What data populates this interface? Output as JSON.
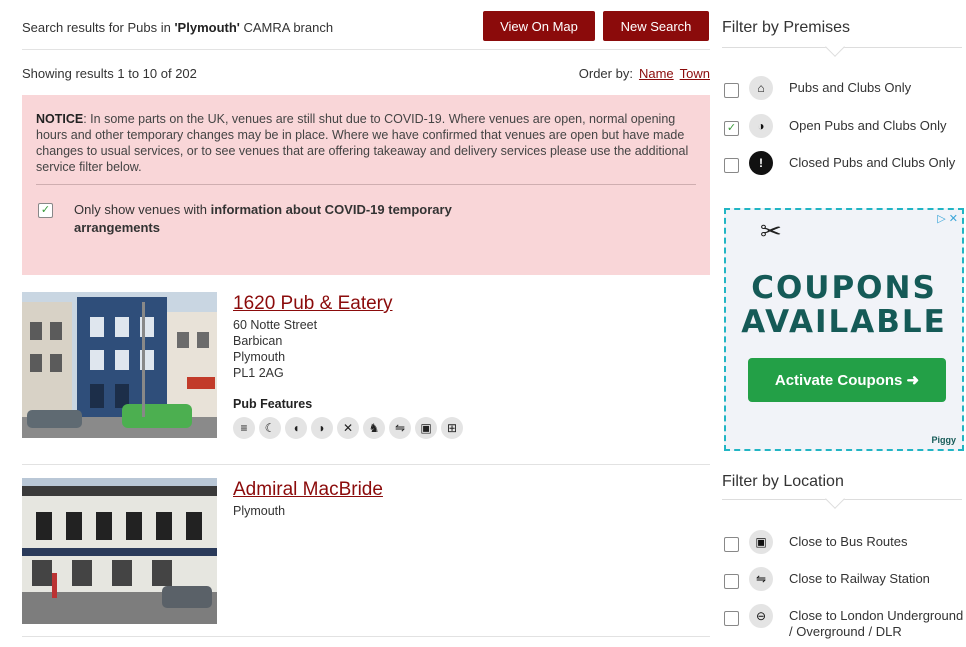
{
  "search": {
    "prefix": "Search results for Pubs in ",
    "place": "'Plymouth'",
    "suffix": " CAMRA branch",
    "view_map_label": "View On Map",
    "new_search_label": "New Search"
  },
  "results": {
    "count_text": "Showing results 1 to 10 of 202",
    "order_label": "Order by:",
    "order_options": [
      "Name",
      "Town"
    ]
  },
  "notice": {
    "heading": "NOTICE",
    "text": ": In some parts on the UK, venues are still shut due to COVID-19. Where venues are open, normal opening hours and other temporary changes may be in place. Where we have confirmed that venues are open but have made changes to usual services, or to see venues that are offering takeaway and delivery services please use the additional service filter below.",
    "covid_prefix": "Only show venues with ",
    "covid_bold": "information about COVID-19 temporary arrangements",
    "covid_checked": true
  },
  "venues": [
    {
      "name": "1620 Pub & Eatery",
      "address": [
        "60 Notte Street",
        "Barbican",
        "Plymouth",
        "PL1 2AG"
      ],
      "features_title": "Pub Features",
      "features": [
        "real-ale-icon",
        "cat-icon",
        "cider-icon",
        "half-moon-icon",
        "cross-icon",
        "dog-icon",
        "train-icon",
        "bus-icon",
        "plus-icon"
      ],
      "feature_glyphs": [
        "≡",
        "☾",
        "◖",
        "◗",
        "✕",
        "♞",
        "⇋",
        "▣",
        "⊞"
      ]
    },
    {
      "name": "Admiral MacBride",
      "address": [
        "Plymouth"
      ]
    }
  ],
  "sidebar": {
    "premises_title": "Filter by Premises",
    "premises_options": [
      {
        "label": "Pubs and Clubs Only",
        "icon": "pub-icon",
        "glyph": "⌂",
        "checked": false
      },
      {
        "label": "Open Pubs and Clubs Only",
        "icon": "half-circle-icon",
        "glyph": "◑",
        "checked": true
      },
      {
        "label": "Closed Pubs and Clubs Only",
        "icon": "exclamation-icon",
        "glyph": "!",
        "checked": false
      }
    ],
    "location_title": "Filter by Location",
    "location_options": [
      {
        "label": "Close to Bus Routes",
        "icon": "bus-icon",
        "glyph": "▣",
        "checked": false
      },
      {
        "label": "Close to Railway Station",
        "icon": "train-icon",
        "glyph": "⇋",
        "checked": false
      },
      {
        "label": "Close to London Underground / Overground / DLR",
        "icon": "underground-icon",
        "glyph": "⊖",
        "checked": false
      }
    ]
  },
  "ad": {
    "line1": "COUPONS",
    "line2": "AVAILABLE",
    "cta": "Activate Coupons ➜",
    "brand": "Piggy",
    "adchoices": "▷ ✕",
    "icon": "scissors-icon"
  },
  "colors": {
    "brand_red": "#8b0b0b",
    "notice_bg": "#f9d6d8",
    "ad_green": "#23a047",
    "ad_teal": "#155a57",
    "ad_border": "#21b5c4"
  }
}
